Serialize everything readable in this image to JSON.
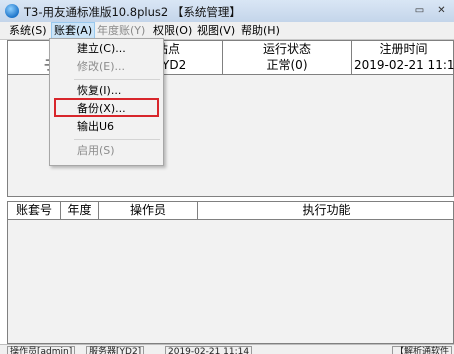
{
  "window": {
    "title": "T3-用友通标准版10.8plus2 【系统管理】",
    "controls": [
      "▭",
      "✕"
    ]
  },
  "menubar": {
    "system": "系统(S)",
    "account": "账套(A)",
    "year": "年度账(Y)",
    "permission": "权限(O)",
    "view": "视图(V)",
    "help": "帮助(H)"
  },
  "account_menu": {
    "items": [
      {
        "label": "建立(C)...",
        "enabled": true
      },
      {
        "label": "修改(E)...",
        "enabled": false
      },
      {
        "label": "恢复(I)...",
        "enabled": true
      },
      {
        "label": "备份(X)...",
        "enabled": true,
        "highlighted": true
      },
      {
        "label": "输出U6",
        "enabled": true
      },
      {
        "label": "启用(S)",
        "enabled": false
      }
    ]
  },
  "sites_table": {
    "columns": [
      "站点",
      "运行状态",
      "注册时间"
    ],
    "rows": [
      {
        "sub": "子",
        "site": "YD2",
        "status": "正常(0)",
        "time": "2019-02-21 11:1"
      }
    ]
  },
  "tasks_table": {
    "columns": [
      "账套号",
      "年度",
      "操作员",
      "执行功能"
    ]
  },
  "statusbar": {
    "operator": "操作员[admin]",
    "server": "服务器[YD2]",
    "datetime": "2019-02-21 11:14",
    "right": "【解析通软件"
  },
  "colors": {
    "highlight_border": "#d8262b",
    "menu_selected": "#cce4f7"
  }
}
